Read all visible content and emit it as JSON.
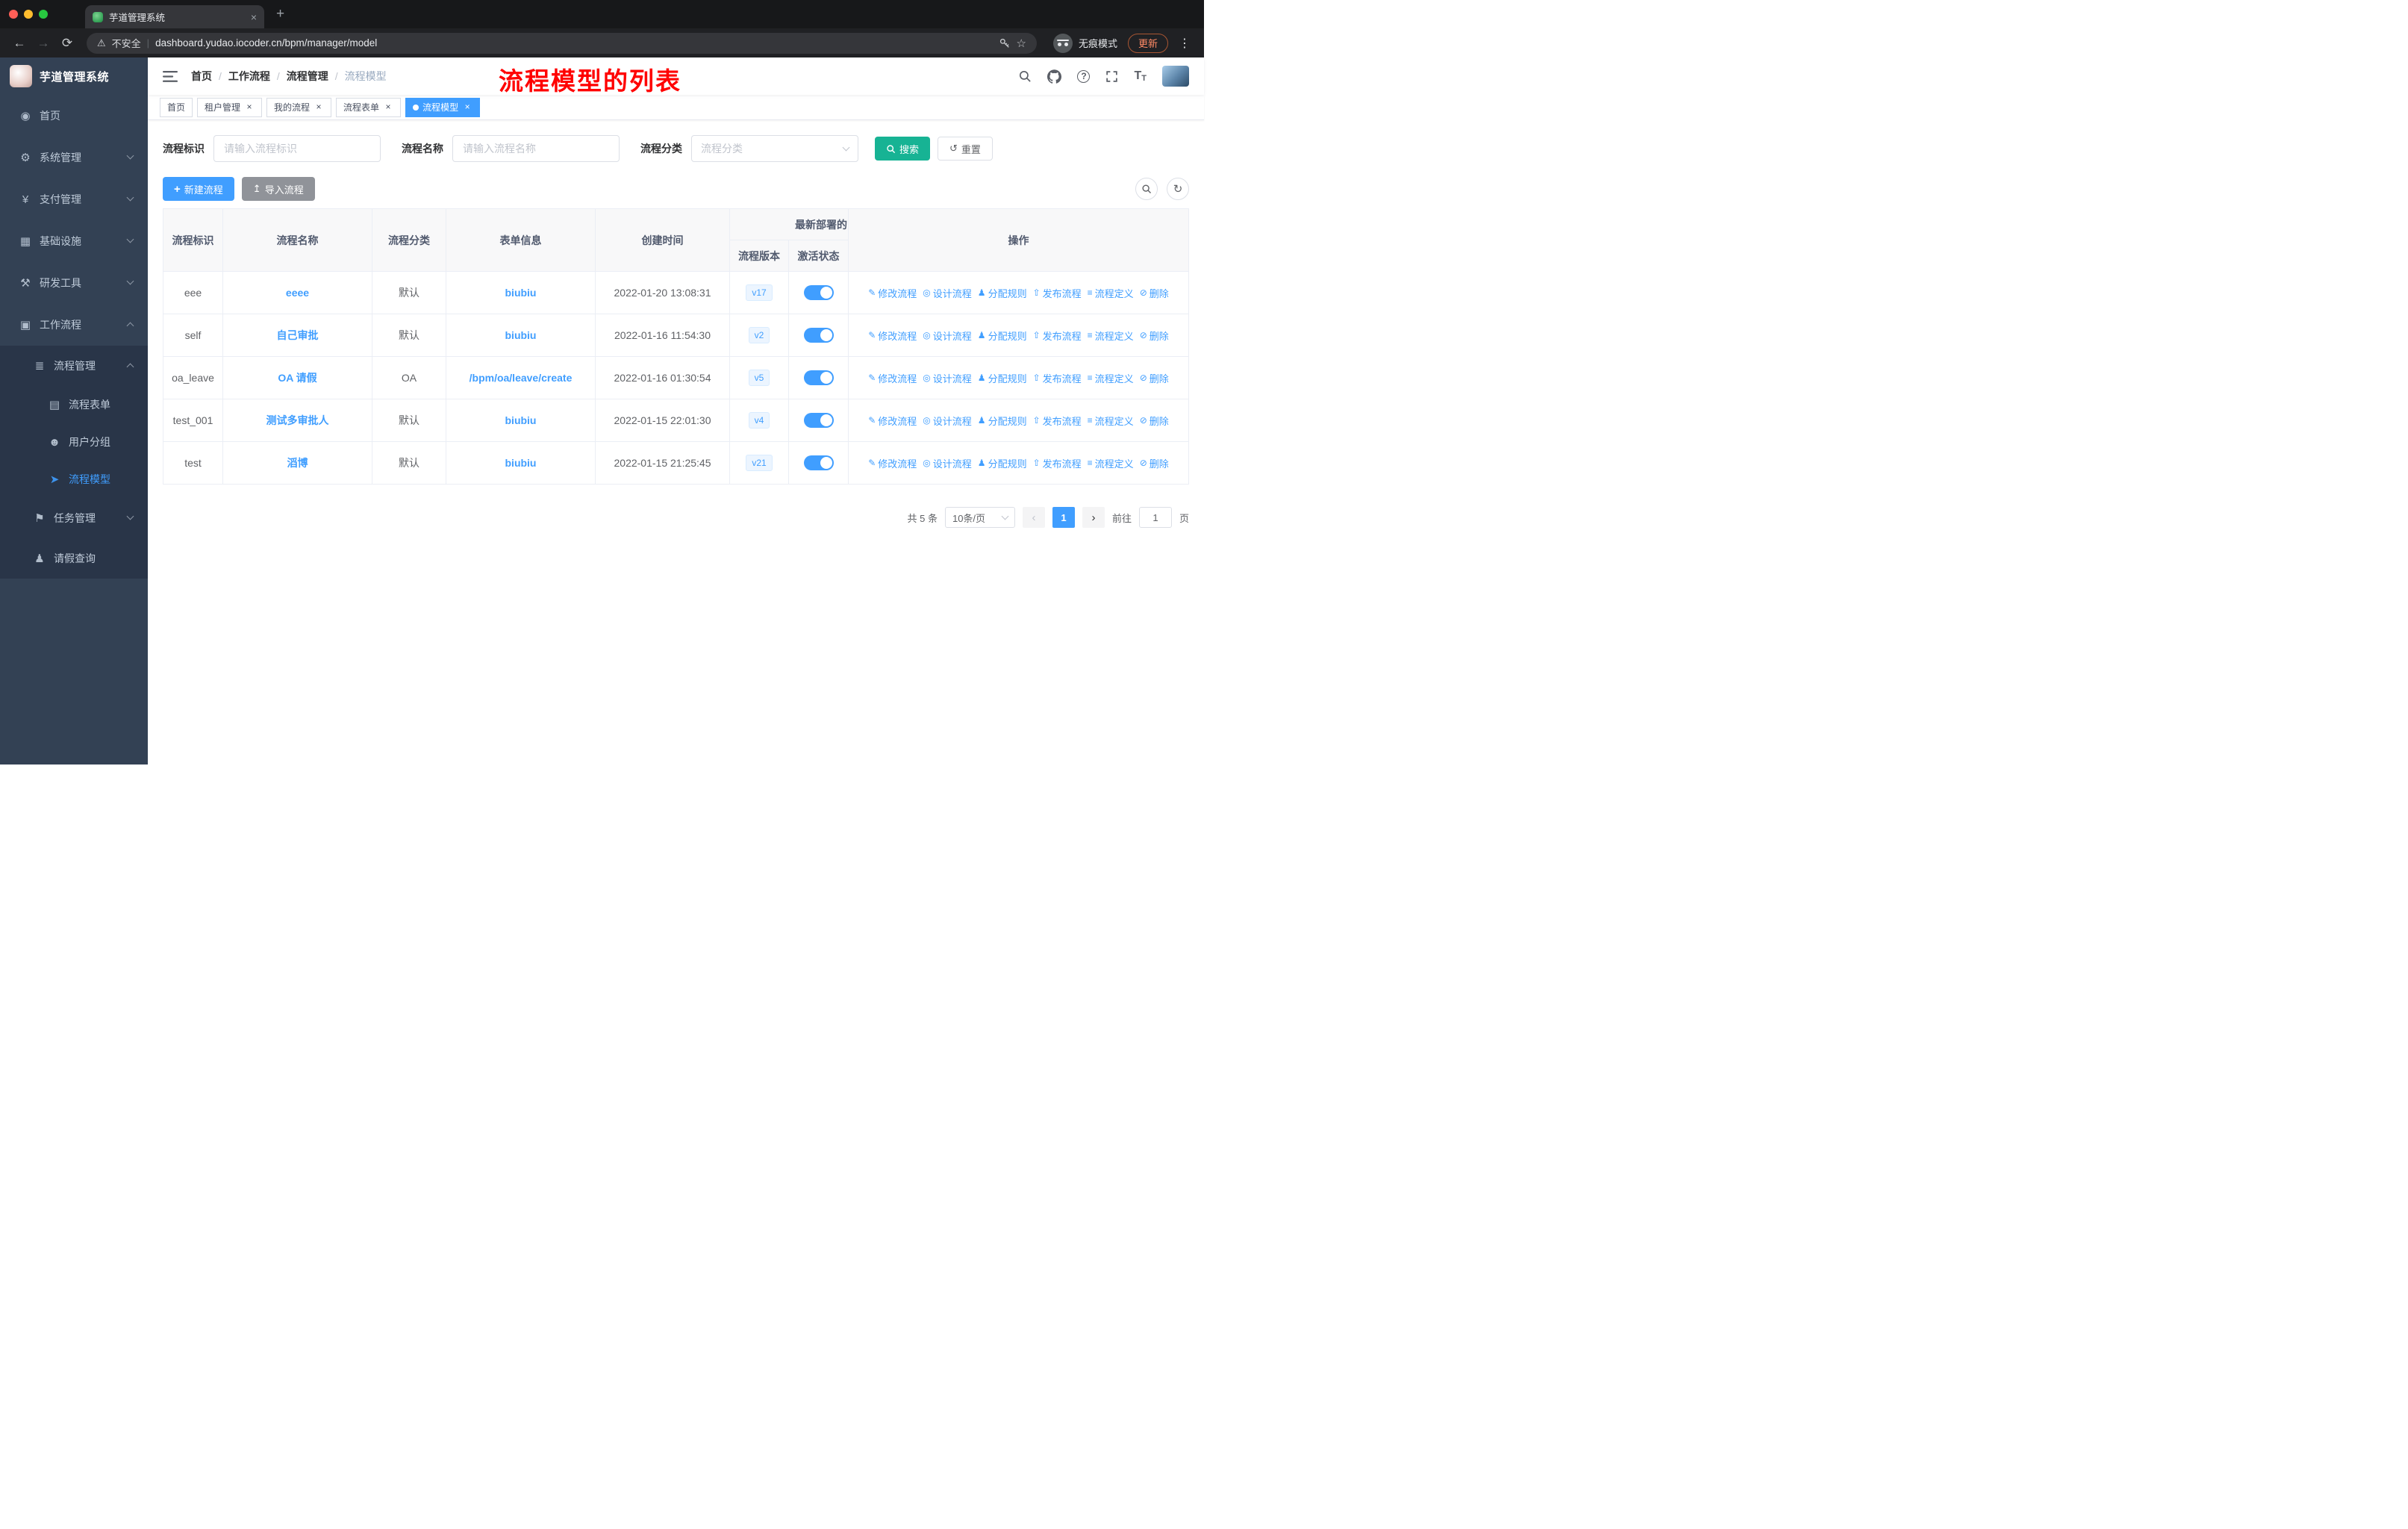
{
  "colors": {
    "accent": "#409eff",
    "search-button": "#17b394",
    "annotation": "#ff0000",
    "sidebar-bg": "#334154",
    "sidebar-sub-bg": "#293548"
  },
  "browser": {
    "tab_title": "芋道管理系统",
    "tab_close_glyph": "×",
    "new_tab_glyph": "+",
    "back_glyph": "←",
    "forward_glyph": "→",
    "reload_glyph": "⟳",
    "warn_glyph": "⚠",
    "security_label": "不安全",
    "divider_glyph": "|",
    "url": "dashboard.yudao.iocoder.cn/bpm/manager/model",
    "star_glyph": "☆",
    "incognito_label": "无痕模式",
    "update_label": "更新",
    "menu_dots_glyph": "⋮"
  },
  "annotation": {
    "text": "流程模型的列表"
  },
  "sidebar": {
    "logo_title": "芋道管理系统",
    "items": [
      {
        "label": "首页",
        "icon": "dashboard-icon",
        "glyph": "◉",
        "level": 1
      },
      {
        "label": "系统管理",
        "icon": "system-manage-icon",
        "glyph": "⚙",
        "level": 1,
        "arrow": "down"
      },
      {
        "label": "支付管理",
        "icon": "payment-manage-icon",
        "glyph": "¥",
        "level": 1,
        "arrow": "down"
      },
      {
        "label": "基础设施",
        "icon": "infrastructure-icon",
        "glyph": "▦",
        "level": 1,
        "arrow": "down"
      },
      {
        "label": "研发工具",
        "icon": "devtools-icon",
        "glyph": "⚒",
        "level": 1,
        "arrow": "down"
      },
      {
        "label": "工作流程",
        "icon": "workflow-icon",
        "glyph": "▣",
        "level": 1,
        "arrow": "up"
      },
      {
        "label": "流程管理",
        "icon": "process-manage-icon",
        "glyph": "≣",
        "level": 2,
        "arrow": "up"
      },
      {
        "label": "流程表单",
        "icon": "process-form-icon",
        "glyph": "▤",
        "level": 3
      },
      {
        "label": "用户分组",
        "icon": "user-group-icon",
        "glyph": "☻",
        "level": 3
      },
      {
        "label": "流程模型",
        "icon": "process-model-icon",
        "glyph": "➤",
        "level": 3,
        "active": true
      },
      {
        "label": "任务管理",
        "icon": "task-manage-icon",
        "glyph": "⚑",
        "level": 2,
        "arrow": "down"
      },
      {
        "label": "请假查询",
        "icon": "leave-query-icon",
        "glyph": "♟",
        "level": 2
      }
    ]
  },
  "header": {
    "breadcrumb": [
      "首页",
      "工作流程",
      "流程管理",
      "流程模型"
    ],
    "navbar_icons": [
      "search-icon",
      "github-icon",
      "help-icon",
      "fullscreen-icon",
      "font-size-icon"
    ]
  },
  "tags": [
    {
      "label": "首页"
    },
    {
      "label": "租户管理",
      "closable": true
    },
    {
      "label": "我的流程",
      "closable": true
    },
    {
      "label": "流程表单",
      "closable": true
    },
    {
      "label": "流程模型",
      "closable": true,
      "active": true
    }
  ],
  "filters": {
    "process_key": {
      "label": "流程标识",
      "placeholder": "请输入流程标识"
    },
    "process_name": {
      "label": "流程名称",
      "placeholder": "请输入流程名称"
    },
    "process_category": {
      "label": "流程分类",
      "placeholder": "流程分类"
    },
    "search_label": "搜索",
    "reset_label": "重置",
    "reset_glyph": "↺"
  },
  "toolbar": {
    "create_label": "新建流程",
    "create_glyph": "+",
    "import_label": "导入流程",
    "import_glyph": "↥",
    "refresh_glyph": "↻"
  },
  "table": {
    "headers": {
      "key": "流程标识",
      "name": "流程名称",
      "category": "流程分类",
      "form": "表单信息",
      "created": "创建时间",
      "deploy_group": "最新部署的",
      "version": "流程版本",
      "active": "激活状态",
      "actions": "操作"
    },
    "row_actions": [
      {
        "label": "修改流程",
        "icon": "edit-icon",
        "glyph": "✎"
      },
      {
        "label": "设计流程",
        "icon": "design-icon",
        "glyph": "◎"
      },
      {
        "label": "分配规则",
        "icon": "assign-icon",
        "glyph": "♟"
      },
      {
        "label": "发布流程",
        "icon": "publish-icon",
        "glyph": "⇧"
      },
      {
        "label": "流程定义",
        "icon": "definition-icon",
        "glyph": "≡"
      },
      {
        "label": "删除",
        "icon": "delete-icon",
        "glyph": "⊘"
      }
    ],
    "rows": [
      {
        "key": "eee",
        "name": "eeee",
        "category": "默认",
        "form": "biubiu",
        "created": "2022-01-20 13:08:31",
        "version": "v17",
        "active": true
      },
      {
        "key": "self",
        "name": "自己审批",
        "category": "默认",
        "form": "biubiu",
        "created": "2022-01-16 11:54:30",
        "version": "v2",
        "active": true
      },
      {
        "key": "oa_leave",
        "name": "OA 请假",
        "category": "OA",
        "form": "/bpm/oa/leave/create",
        "created": "2022-01-16 01:30:54",
        "version": "v5",
        "active": true
      },
      {
        "key": "test_001",
        "name": "测试多审批人",
        "category": "默认",
        "form": "biubiu",
        "created": "2022-01-15 22:01:30",
        "version": "v4",
        "active": true
      },
      {
        "key": "test",
        "name": "滔博",
        "category": "默认",
        "form": "biubiu",
        "created": "2022-01-15 21:25:45",
        "version": "v21",
        "active": true
      }
    ]
  },
  "pagination": {
    "total_label": "共 5 条",
    "page_size": "10条/页",
    "prev_glyph": "‹",
    "next_glyph": "›",
    "current_page": "1",
    "goto_label": "前往",
    "goto_value": "1",
    "page_suffix": "页"
  }
}
